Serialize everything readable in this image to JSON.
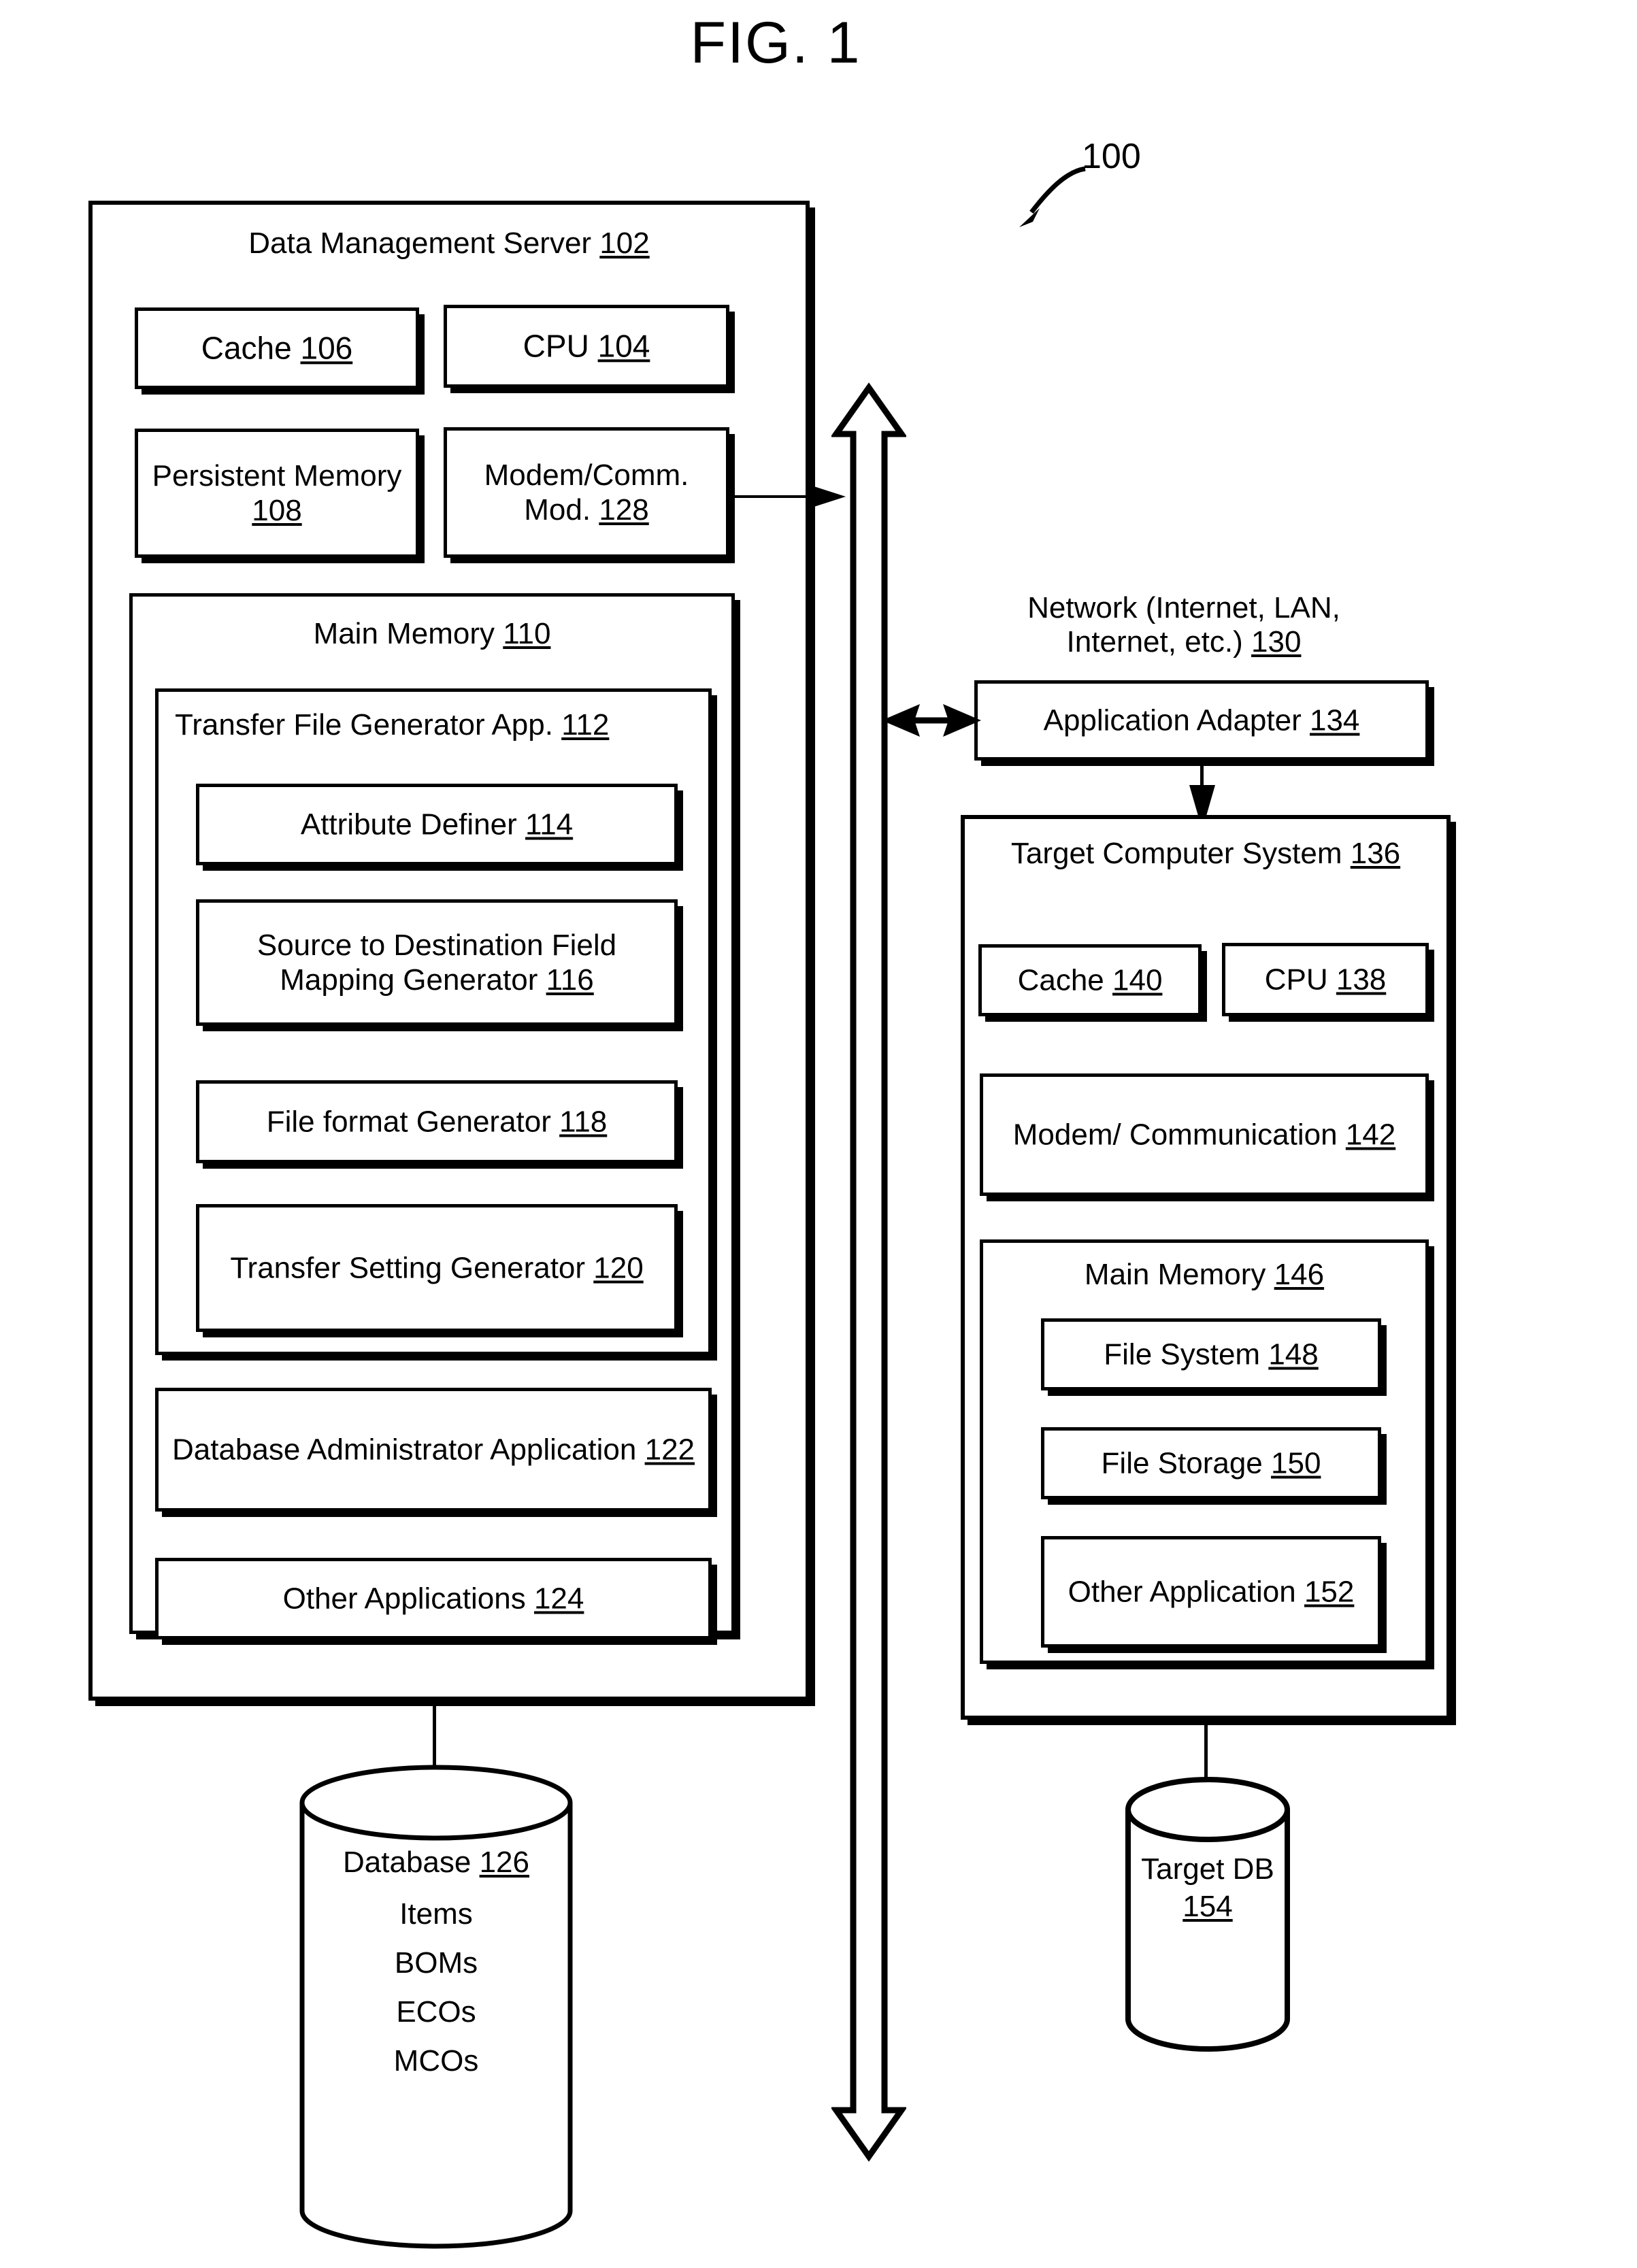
{
  "figure": {
    "title": "FIG. 1",
    "system_ref": "100"
  },
  "server": {
    "title_text": "Data Management Server ",
    "title_ref": "102",
    "cache": {
      "text": "Cache ",
      "ref": "106"
    },
    "cpu": {
      "text": "CPU ",
      "ref": "104"
    },
    "persistent_memory": {
      "text": "Persistent\nMemory ",
      "ref": "108"
    },
    "modem": {
      "text": "Modem/Comm.\nMod. ",
      "ref": "128"
    },
    "main_memory": {
      "title_text": "Main Memory ",
      "title_ref": "110"
    },
    "transfer_file_generator": {
      "title_text": "Transfer File Generator App. ",
      "title_ref": "112",
      "modules": [
        {
          "text": "Attribute Definer ",
          "ref": "114"
        },
        {
          "text": "Source to Destination Field\nMapping Generator ",
          "ref": "116"
        },
        {
          "text": "File format Generator ",
          "ref": "118"
        },
        {
          "text": "Transfer Setting\nGenerator ",
          "ref": "120"
        }
      ]
    },
    "db_admin_app": {
      "text": "Database Administrator\nApplication ",
      "ref": "122"
    },
    "other_applications": {
      "text": "Other Applications ",
      "ref": "124"
    }
  },
  "database": {
    "title_text": "Database ",
    "title_ref": "126",
    "contents": [
      "Items",
      "BOMs",
      "ECOs",
      "MCOs"
    ]
  },
  "network": {
    "text": "Network (Internet, LAN,\nInternet, etc.) ",
    "ref": "130",
    "application_adapter": {
      "text": "Application Adapter ",
      "ref": "134"
    }
  },
  "target_system": {
    "title_text": "Target Computer\nSystem ",
    "title_ref": "136",
    "cache": {
      "text": "Cache ",
      "ref": "140"
    },
    "cpu": {
      "text": "CPU ",
      "ref": "138"
    },
    "modem": {
      "text": "Modem/\nCommunication ",
      "ref": "142"
    },
    "main_memory": {
      "title_text": "Main Memory ",
      "title_ref": "146",
      "modules": [
        {
          "text": "File System ",
          "ref": "148"
        },
        {
          "text": "File Storage ",
          "ref": "150"
        },
        {
          "text": "Other Application\n",
          "ref": "152"
        }
      ]
    }
  },
  "target_db": {
    "text": "Target\nDB ",
    "ref": "154"
  }
}
